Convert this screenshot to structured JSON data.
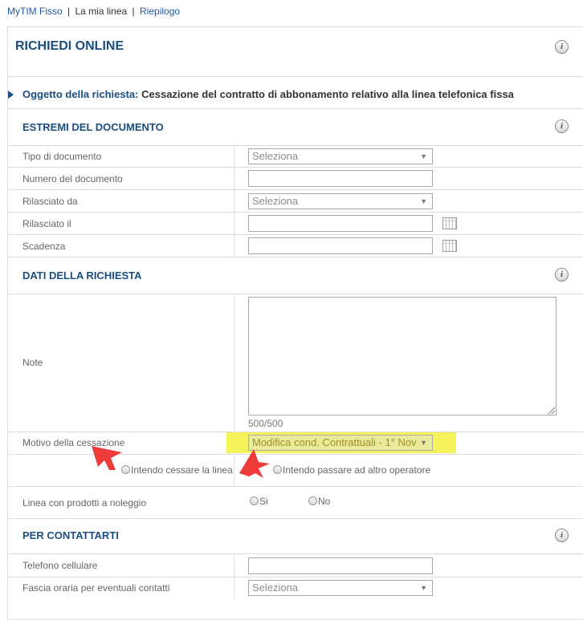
{
  "breadcrumb": {
    "item1": "MyTIM Fisso",
    "sep1": "|",
    "item2": "La mia linea",
    "sep2": "|",
    "item3": "Riepilogo"
  },
  "header": {
    "title": "RICHIEDI ONLINE",
    "info": "i"
  },
  "oggetto": {
    "label": "Oggetto della richiesta:",
    "value": "Cessazione del contratto di abbonamento relativo alla linea telefonica fissa"
  },
  "estremi": {
    "title": "ESTREMI DEL DOCUMENTO",
    "tipo_label": "Tipo di documento",
    "tipo_value": "Seleziona",
    "numero_label": "Numero del documento",
    "rilasciato_da_label": "Rilasciato da",
    "rilasciato_da_value": "Seleziona",
    "rilasciato_il_label": "Rilasciato il",
    "scadenza_label": "Scadenza"
  },
  "dati": {
    "title": "DATI DELLA RICHIESTA",
    "note_label": "Note",
    "counter": "500/500",
    "motivo_label": "Motivo della cessazione",
    "motivo_value": "Modifica cond. Contrattuali - 1° Nov",
    "radio_cessare": "Intendo cessare la linea",
    "radio_passare": "Intendo passare ad altro operatore",
    "noleggio_label": "Linea con prodotti a noleggio",
    "radio_si": "Si",
    "radio_no": "No"
  },
  "contatti": {
    "title": "PER CONTATTARTI",
    "cellulare_label": "Telefono cellulare",
    "fascia_label": "Fascia oraria per eventuali contatti",
    "fascia_value": "Seleziona"
  },
  "colors": {
    "accent": "#1a4d80",
    "highlight": "#f6f35a",
    "annotation_arrow": "#ee3b3b"
  }
}
